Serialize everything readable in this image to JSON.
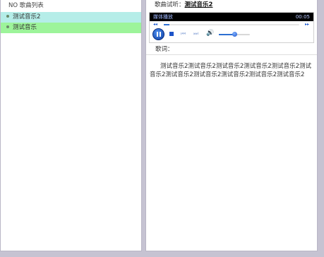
{
  "song_list": {
    "header": "NO 歌曲列表",
    "items": [
      {
        "label": "测试音乐2",
        "row_color": "#b5ede8"
      },
      {
        "label": "测试音乐",
        "row_color": "#9df49a"
      }
    ]
  },
  "listen": {
    "label": "歌曲试听：",
    "title": "测试音乐2"
  },
  "player": {
    "status_label": "媒体播放",
    "time": "00:05",
    "seek_progress": 0.04,
    "volume_level": 0.5,
    "accent_color": "#1d54c8",
    "icons": [
      "pause-icon",
      "stop-icon",
      "previous-icon",
      "next-icon",
      "volume-icon"
    ]
  },
  "lyrics": {
    "label": "歌词：",
    "text": "测试音乐2测试音乐2测试音乐2测试音乐2测试音乐2测试音乐2测试音乐2测试音乐2测试音乐2测试音乐2测试音乐2"
  }
}
